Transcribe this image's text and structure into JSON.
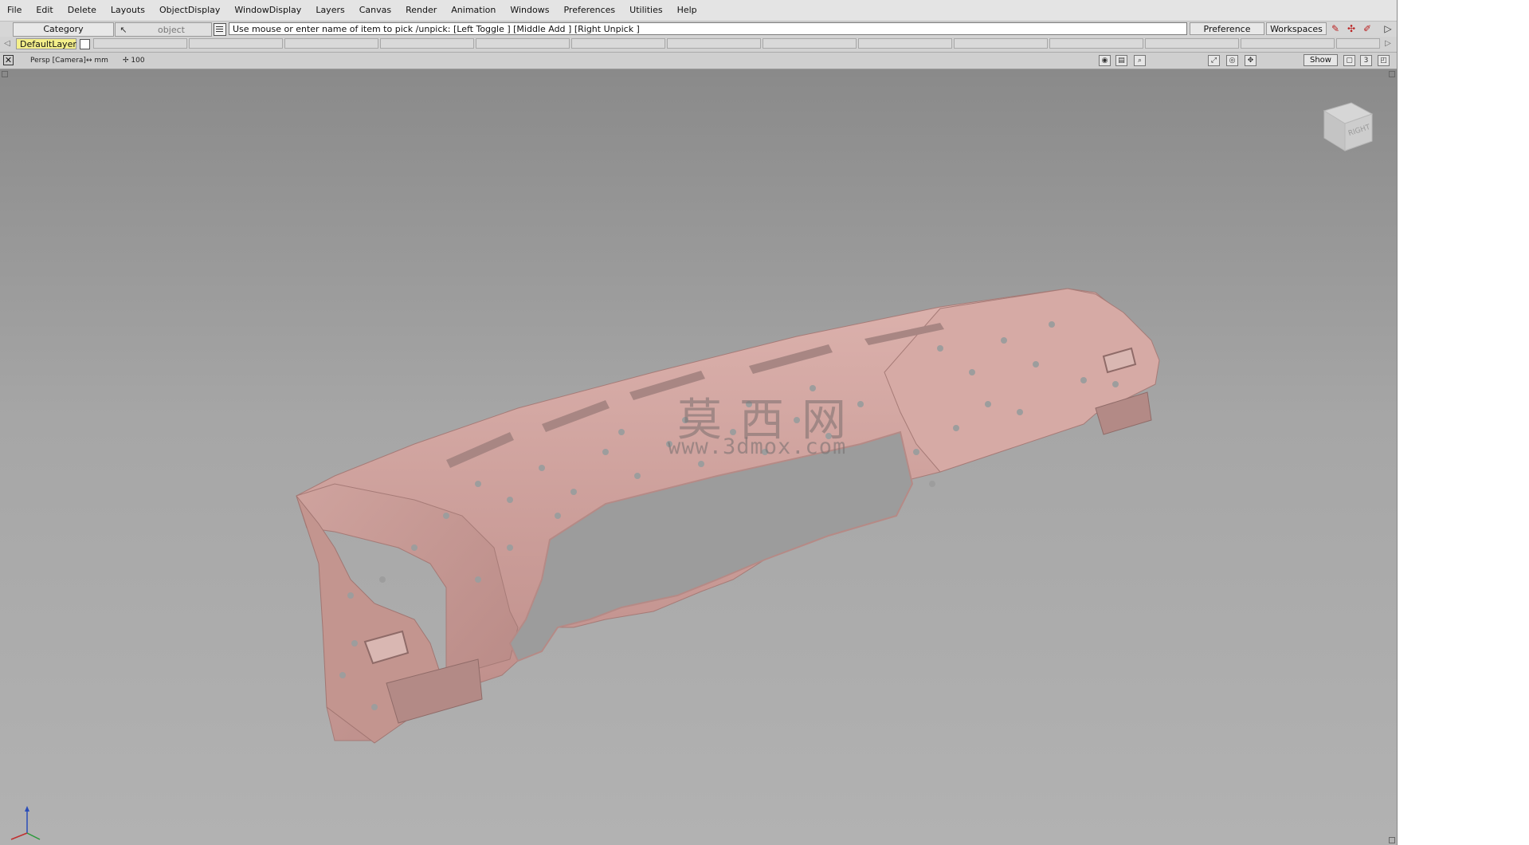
{
  "menubar": {
    "items": [
      "File",
      "Edit",
      "Delete",
      "Layouts",
      "ObjectDisplay",
      "WindowDisplay",
      "Layers",
      "Canvas",
      "Render",
      "Animation",
      "Windows",
      "Preferences",
      "Utilities",
      "Help"
    ]
  },
  "control": {
    "category": "Category",
    "pick_mode": "object",
    "prompt": "Use mouse or enter name of item to pick /unpick: [Left Toggle ] [Middle Add ] [Right Unpick ]",
    "preference_sets": "Preference Sets",
    "workspaces": "Workspaces"
  },
  "layers": {
    "default": "DefaultLayer"
  },
  "viewport": {
    "camera": "Persp [Camera]",
    "units": "mm",
    "grid_size": "100",
    "show_label": "Show",
    "layout_number": "3",
    "viewcube_face": "RIGHT"
  },
  "watermark": {
    "chinese": "莫西网",
    "url": "www.3dmox.com"
  },
  "colors": {
    "model": "#c99a96",
    "model_shadow": "#a87e7b",
    "model_highlight": "#dbb3ae",
    "viewport_top": "#8a8a8a",
    "viewport_bottom": "#b2b2b2"
  },
  "icons": [
    "pick-icon",
    "list-icon",
    "shelf-icon-1",
    "shelf-icon-2",
    "shelf-icon-3",
    "expand-arrow-icon",
    "close-viewport-icon",
    "units-arrow-icon",
    "grid-icon",
    "camera-icon",
    "bookmark-icon",
    "zoom-icon",
    "fit-icon",
    "target-icon",
    "move-icon",
    "layout-icon",
    "maximize-icon",
    "axis-triad-icon"
  ]
}
